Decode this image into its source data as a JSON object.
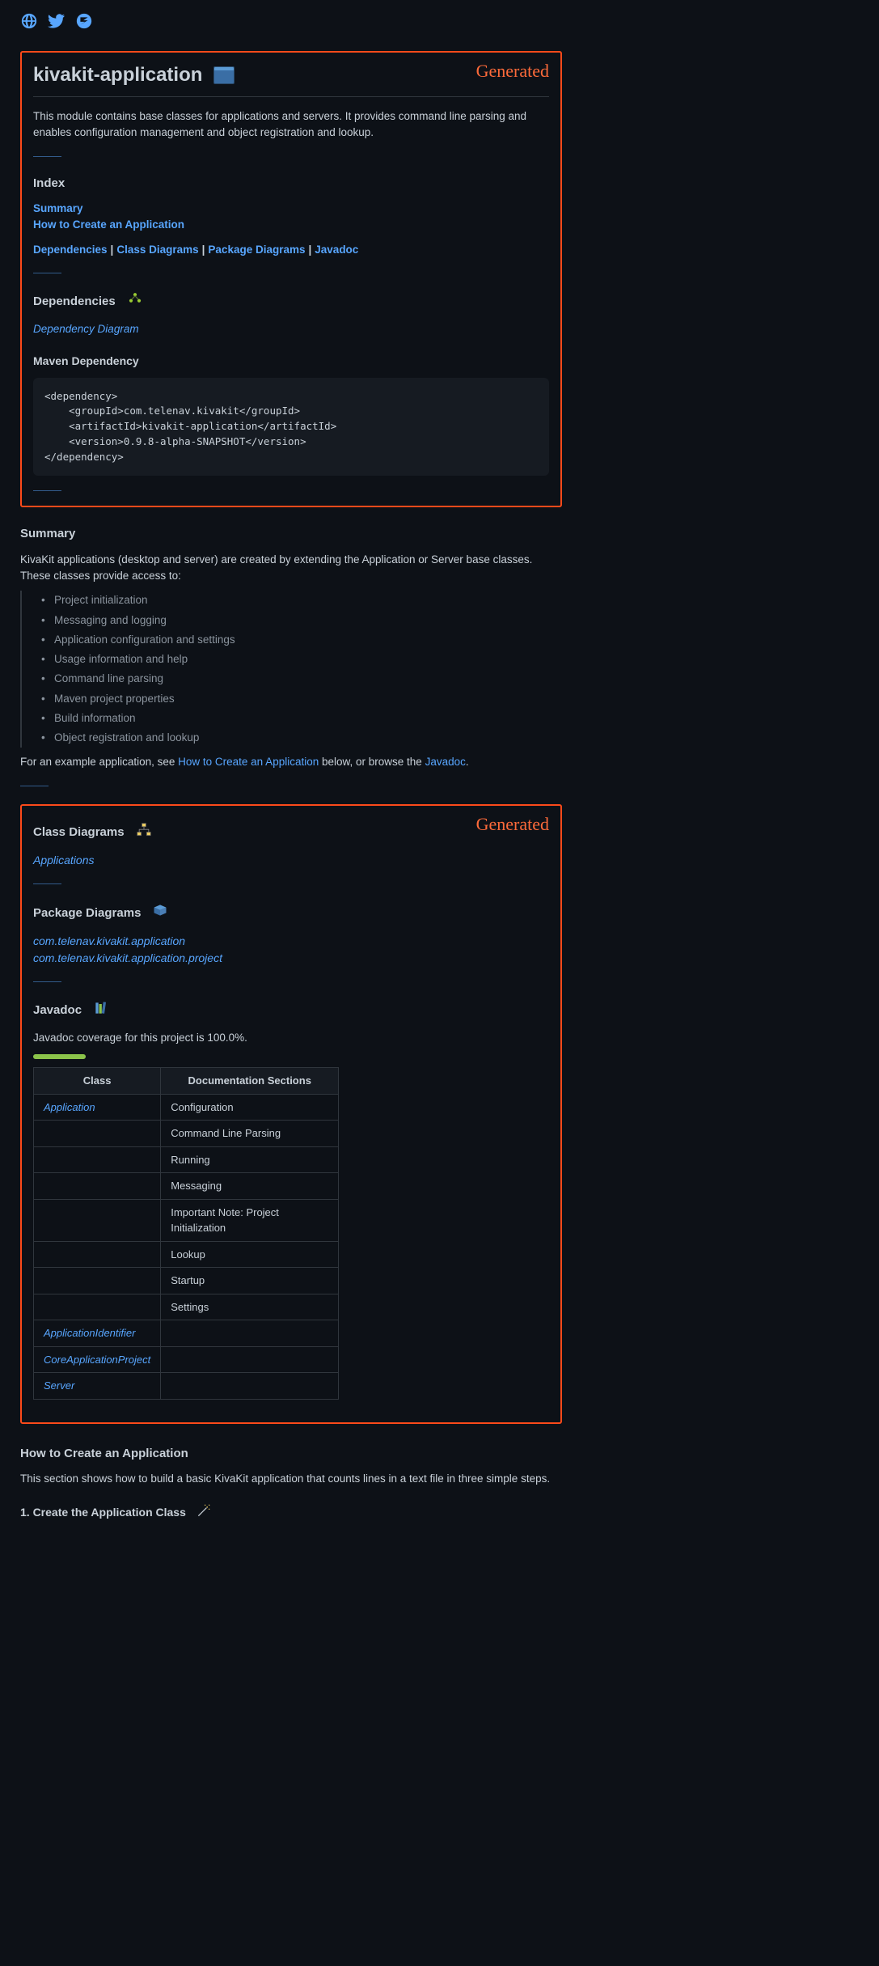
{
  "generated_label": "Generated",
  "header": {
    "title": "kivakit-application"
  },
  "intro": "This module contains base classes for applications and servers. It provides command line parsing and enables configuration management and object registration and lookup.",
  "index": {
    "heading": "Index",
    "links": {
      "summary": "Summary",
      "howto": "How to Create an Application"
    },
    "row": {
      "deps": "Dependencies",
      "class_diag": "Class Diagrams",
      "pkg_diag": "Package Diagrams",
      "javadoc": "Javadoc"
    }
  },
  "deps": {
    "heading": "Dependencies",
    "diagram_link": "Dependency Diagram",
    "maven_heading": "Maven Dependency",
    "maven_xml": "<dependency>\n    <groupId>com.telenav.kivakit</groupId>\n    <artifactId>kivakit-application</artifactId>\n    <version>0.9.8-alpha-SNAPSHOT</version>\n</dependency>"
  },
  "summary": {
    "heading": "Summary",
    "intro": "KivaKit applications (desktop and server) are created by extending the Application or Server base classes. These classes provide access to:",
    "items": [
      "Project initialization",
      "Messaging and logging",
      "Application configuration and settings",
      "Usage information and help",
      "Command line parsing",
      "Maven project properties",
      "Build information",
      "Object registration and lookup"
    ],
    "outro_pre": "For an example application, see ",
    "outro_link": "How to Create an Application",
    "outro_mid": " below, or browse the ",
    "outro_link2": "Javadoc",
    "outro_post": "."
  },
  "class_diagrams": {
    "heading": "Class Diagrams",
    "links": [
      "Applications"
    ]
  },
  "package_diagrams": {
    "heading": "Package Diagrams",
    "links": [
      "com.telenav.kivakit.application",
      "com.telenav.kivakit.application.project"
    ]
  },
  "javadoc": {
    "heading": "Javadoc",
    "coverage_text": "Javadoc coverage for this project is 100.0%.",
    "coverage_pct": 100,
    "table": {
      "headers": {
        "class": "Class",
        "sections": "Documentation Sections"
      },
      "rows": [
        {
          "class": "Application",
          "section": "Configuration"
        },
        {
          "class": "",
          "section": "Command Line Parsing"
        },
        {
          "class": "",
          "section": "Running"
        },
        {
          "class": "",
          "section": "Messaging"
        },
        {
          "class": "",
          "section": "Important Note: Project Initialization"
        },
        {
          "class": "",
          "section": "Lookup"
        },
        {
          "class": "",
          "section": "Startup"
        },
        {
          "class": "",
          "section": "Settings"
        },
        {
          "class": "ApplicationIdentifier",
          "section": ""
        },
        {
          "class": "CoreApplicationProject",
          "section": ""
        },
        {
          "class": "Server",
          "section": ""
        }
      ]
    }
  },
  "howto": {
    "heading": "How to Create an Application",
    "intro": "This section shows how to build a basic KivaKit application that counts lines in a text file in three simple steps.",
    "step1": "1. Create the Application Class"
  }
}
